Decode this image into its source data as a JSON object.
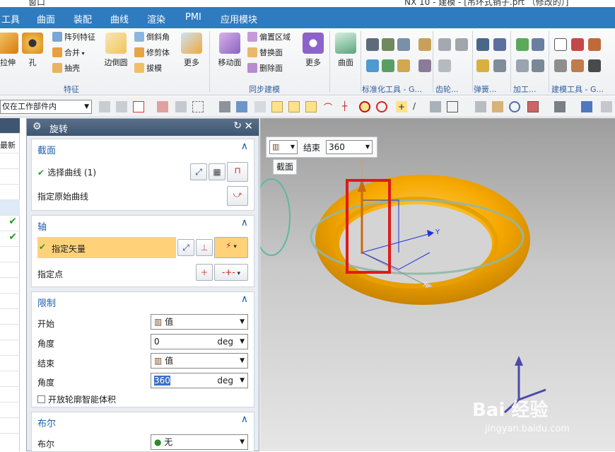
{
  "window": {
    "title_left": "窗口",
    "title_right": "NX 10 - 建模 - [吊环式销子.prt （修改的）]"
  },
  "menubar": {
    "items": [
      "工具",
      "曲面",
      "装配",
      "曲线",
      "渲染",
      "PMI",
      "应用模块"
    ]
  },
  "ribbon": {
    "big_buttons": [
      "拉伸",
      "孔",
      "边倒圆",
      "更多",
      "移动面",
      "更多",
      "曲面"
    ],
    "small_buttons": [
      "阵列特征",
      "合并",
      "抽壳",
      "倒斜角",
      "修剪体",
      "拔模",
      "偏置区域",
      "替换面",
      "删除面"
    ],
    "groups": [
      "特征",
      "同步建模",
      "标准化工具 - G...",
      "齿轮...",
      "弹簧...",
      "加工...",
      "建模工具 - G..."
    ]
  },
  "toolbar2": {
    "filter_value": "仅在工作部件内"
  },
  "left_strip": {
    "header": "最新"
  },
  "dialog": {
    "title": "旋转",
    "sections": {
      "section": {
        "title": "截面",
        "select_curve": "选择曲线 (1)",
        "specify_origin_curve": "指定原始曲线"
      },
      "axis": {
        "title": "轴",
        "specify_vector": "指定矢量",
        "specify_point": "指定点"
      },
      "limits": {
        "title": "限制",
        "start_label": "开始",
        "start_value": "值",
        "start_angle_label": "角度",
        "start_angle": "0",
        "start_unit": "deg",
        "end_label": "结束",
        "end_value": "值",
        "end_angle_label": "角度",
        "end_angle": "360",
        "end_unit": "deg",
        "checkbox_label": "开放轮廓智能体积"
      },
      "boolean": {
        "title": "布尔",
        "label": "布尔",
        "value": "无"
      }
    }
  },
  "viewport": {
    "end_label": "结束",
    "end_value": "360",
    "section_tip": "截面",
    "axis_labels": {
      "y": "Y",
      "x": "X",
      "z": "Z"
    },
    "watermark_text": "Bai 经验",
    "watermark_url": "jingyan.baidu.com"
  },
  "colors": {
    "menubar": "#2f7bbf",
    "torus": "#f6a800",
    "highlight": "#ffd27a",
    "red_box": "#e01a1a",
    "accent": "#1f5fae"
  }
}
